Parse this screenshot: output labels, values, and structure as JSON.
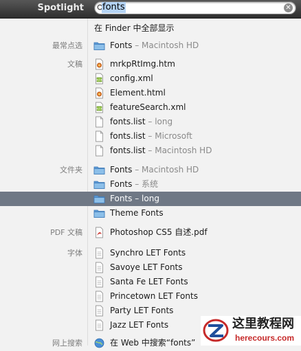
{
  "header": {
    "title": "Spotlight",
    "search_value": "fonts"
  },
  "rows": [
    {
      "category": "",
      "title": "在 Finder 中全部显示",
      "subtitle": "",
      "icon": "none"
    },
    {
      "category": "最常点选",
      "title": "Fonts",
      "subtitle": "Macintosh HD",
      "icon": "folder-icon"
    },
    {
      "category": "文稿",
      "title": "mrkpRtImg.htm",
      "subtitle": "",
      "icon": "html-file-icon"
    },
    {
      "category": "",
      "title": "config.xml",
      "subtitle": "",
      "icon": "xml-file-icon"
    },
    {
      "category": "",
      "title": "Element.html",
      "subtitle": "",
      "icon": "html-file-icon"
    },
    {
      "category": "",
      "title": "featureSearch.xml",
      "subtitle": "",
      "icon": "xml-file-icon"
    },
    {
      "category": "",
      "title": "fonts.list",
      "subtitle": "long",
      "icon": "document-icon"
    },
    {
      "category": "",
      "title": "fonts.list",
      "subtitle": "Microsoft",
      "icon": "document-icon"
    },
    {
      "category": "",
      "title": "fonts.list",
      "subtitle": "Macintosh HD",
      "icon": "document-icon"
    },
    {
      "category": "文件夹",
      "title": "Fonts",
      "subtitle": "Macintosh HD",
      "icon": "folder-icon"
    },
    {
      "category": "",
      "title": "Fonts",
      "subtitle": "系统",
      "icon": "folder-icon"
    },
    {
      "category": "",
      "title": "Fonts",
      "subtitle": "long",
      "icon": "folder-icon",
      "selected": true
    },
    {
      "category": "",
      "title": "Theme Fonts",
      "subtitle": "",
      "icon": "folder-icon"
    },
    {
      "category": "PDF 文稿",
      "title": "Photoshop CS5 自述.pdf",
      "subtitle": "",
      "icon": "pdf-file-icon"
    },
    {
      "category": "字体",
      "title": "Synchro LET Fonts",
      "subtitle": "",
      "icon": "font-file-icon"
    },
    {
      "category": "",
      "title": "Savoye LET Fonts",
      "subtitle": "",
      "icon": "font-file-icon"
    },
    {
      "category": "",
      "title": "Santa Fe LET Fonts",
      "subtitle": "",
      "icon": "font-file-icon"
    },
    {
      "category": "",
      "title": "Princetown LET Fonts",
      "subtitle": "",
      "icon": "font-file-icon"
    },
    {
      "category": "",
      "title": "Party LET Fonts",
      "subtitle": "",
      "icon": "font-file-icon"
    },
    {
      "category": "",
      "title": "Jazz LET Fonts",
      "subtitle": "",
      "icon": "font-file-icon"
    },
    {
      "category": "网上搜索",
      "title": "在 Web 中搜索“fonts”",
      "subtitle": "",
      "icon": "globe-icon"
    }
  ],
  "watermark": {
    "title": "这里教程网",
    "url": "herecours.com"
  },
  "colors": {
    "header_bg": "#3c3c3c",
    "selection_bg": "#6f7885",
    "folder_blue": "#6aa6dc",
    "pdf_red": "#c8312b"
  }
}
